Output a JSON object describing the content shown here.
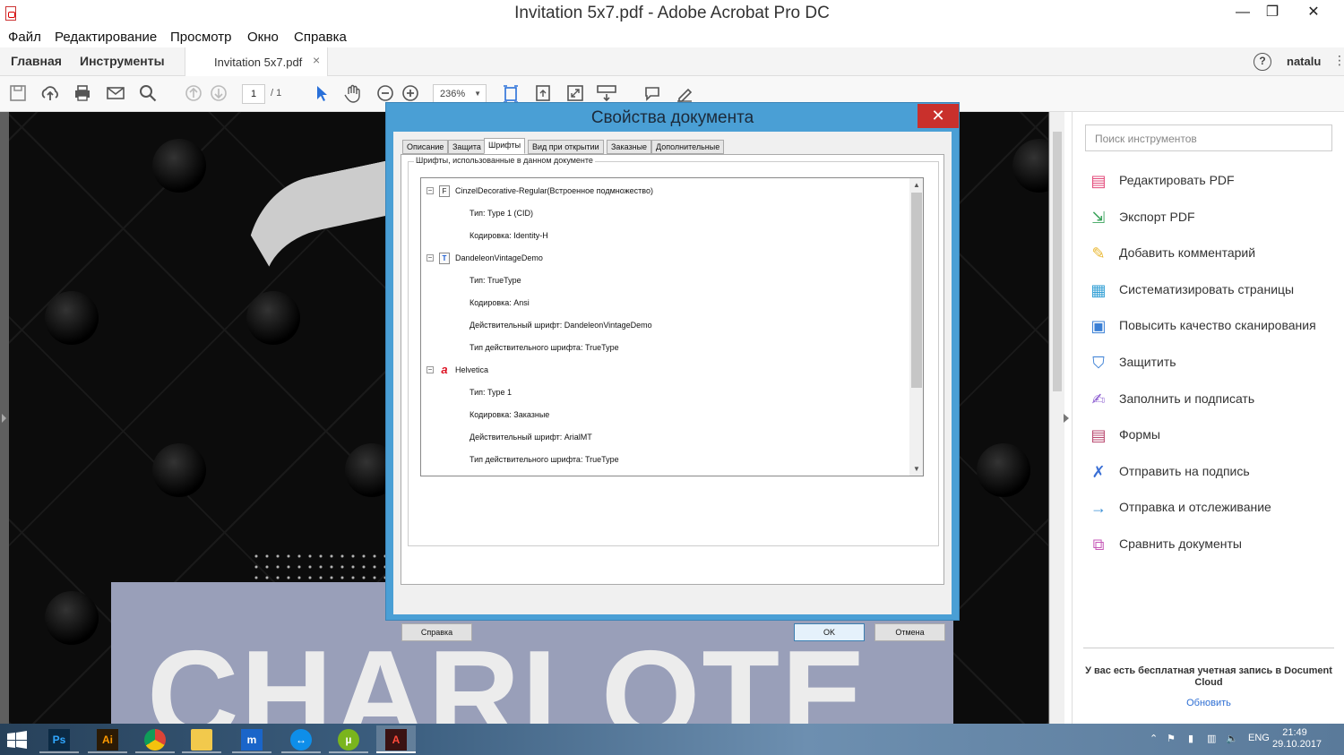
{
  "window": {
    "title": "Invitation 5x7.pdf - Adobe Acrobat Pro DC",
    "minimize": "—",
    "maximize": "❐",
    "close": "✕"
  },
  "menu": [
    "Файл",
    "Редактирование",
    "Просмотр",
    "Окно",
    "Справка"
  ],
  "tabs": {
    "home": "Главная",
    "tools": "Инструменты",
    "doc": "Invitation 5x7.pdf",
    "doc_close": "×",
    "help": "?",
    "user": "natalu"
  },
  "toolbar": {
    "page_current": "1",
    "page_total": "/ 1",
    "zoom": "236%"
  },
  "document": {
    "card_text": "CHARLOTE"
  },
  "right_pane": {
    "search_placeholder": "Поиск инструментов",
    "tools": [
      {
        "label": "Редактировать PDF",
        "icon": "edit-pdf-icon",
        "color": "#e34a7a"
      },
      {
        "label": "Экспорт PDF",
        "icon": "export-pdf-icon",
        "color": "#3aa35b"
      },
      {
        "label": "Добавить комментарий",
        "icon": "comment-icon",
        "color": "#e9b730"
      },
      {
        "label": "Систематизировать страницы",
        "icon": "organize-pages-icon",
        "color": "#34a0d5"
      },
      {
        "label": "Повысить качество сканирования",
        "icon": "enhance-scan-icon",
        "color": "#3a7fd5"
      },
      {
        "label": "Защитить",
        "icon": "protect-icon",
        "color": "#3a7fd5"
      },
      {
        "label": "Заполнить и подписать",
        "icon": "fill-sign-icon",
        "color": "#8d5ed1"
      },
      {
        "label": "Формы",
        "icon": "forms-icon",
        "color": "#b9476e"
      },
      {
        "label": "Отправить на подпись",
        "icon": "send-sign-icon",
        "color": "#3a6fd5"
      },
      {
        "label": "Отправка и отслеживание",
        "icon": "send-track-icon",
        "color": "#3a8fd5"
      },
      {
        "label": "Сравнить документы",
        "icon": "compare-icon",
        "color": "#c659b8"
      }
    ],
    "account_text": "У вас есть бесплатная учетная запись в Document Cloud",
    "update_link": "Обновить"
  },
  "dialog": {
    "title": "Свойства документа",
    "close": "✕",
    "tabs": [
      "Описание",
      "Защита",
      "Шрифты",
      "Вид при открытии",
      "Заказные",
      "Дополнительные"
    ],
    "active_tab": "Шрифты",
    "group_label": "Шрифты, использованные в данном документе",
    "fonts": [
      {
        "name": "CinzelDecorative-Regular(Встроенное подмножество)",
        "icon_char": "F",
        "props": [
          "Тип: Type 1 (CID)",
          "Кодировка: Identity-H"
        ]
      },
      {
        "name": "DandeleonVintageDemo",
        "icon_char": "T",
        "props": [
          "Тип: TrueType",
          "Кодировка: Ansi",
          "Действительный шрифт: DandeleonVintageDemo",
          "Тип действительного шрифта: TrueType"
        ]
      },
      {
        "name": "Helvetica",
        "icon_char": "a",
        "props": [
          "Тип: Type 1",
          "Кодировка: Заказные",
          "Действительный шрифт: ArialMT",
          "Тип действительного шрифта: TrueType"
        ]
      }
    ],
    "buttons": {
      "help": "Справка",
      "ok": "OK",
      "cancel": "Отмена"
    }
  },
  "taskbar": {
    "apps": [
      {
        "name": "photoshop-app",
        "label": "Ps",
        "bg": "#0b2a44",
        "fg": "#31a8ff"
      },
      {
        "name": "illustrator-app",
        "label": "Ai",
        "bg": "#2b1a05",
        "fg": "#ff9a00"
      },
      {
        "name": "chrome-app",
        "label": "",
        "bg": "transparent",
        "fg": "#fff"
      },
      {
        "name": "explorer-app",
        "label": "",
        "bg": "transparent",
        "fg": "#fff"
      },
      {
        "name": "app-m",
        "label": "m",
        "bg": "#1a65c9",
        "fg": "#fff"
      },
      {
        "name": "teamviewer-app",
        "label": "↔",
        "bg": "#0e8ee9",
        "fg": "#fff"
      },
      {
        "name": "utorrent-app",
        "label": "µ",
        "bg": "#7ab51d",
        "fg": "#fff"
      },
      {
        "name": "acrobat-app",
        "label": "A",
        "bg": "#3a1212",
        "fg": "#ff4a3a"
      }
    ],
    "lang": "ENG",
    "time": "21:49",
    "date": "29.10.2017"
  }
}
